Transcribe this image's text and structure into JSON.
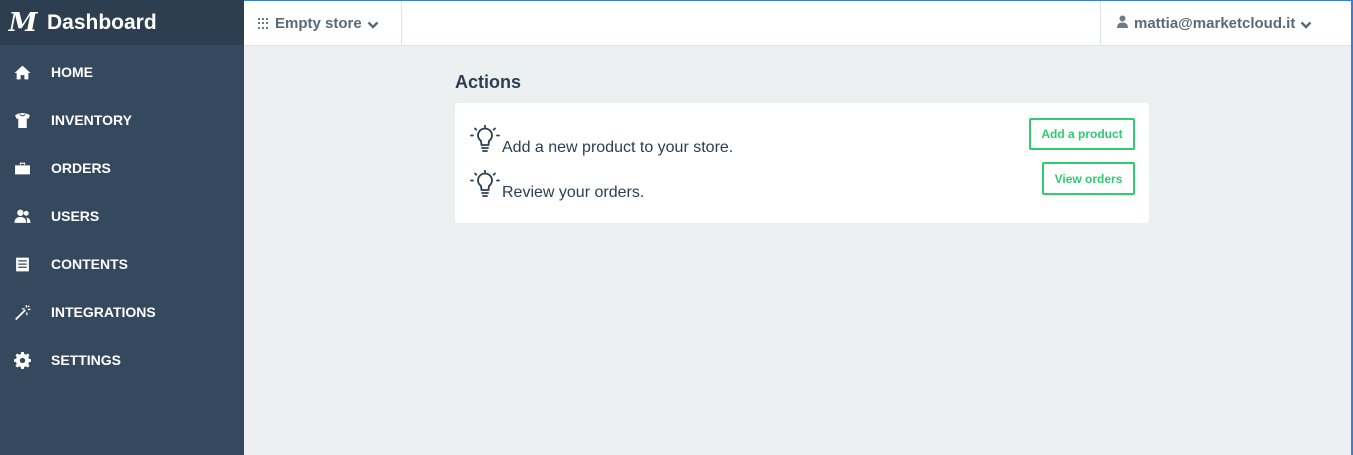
{
  "brand": {
    "logo": "M",
    "title": "Dashboard"
  },
  "sidebar": {
    "items": [
      {
        "label": "HOME",
        "icon": "home-icon"
      },
      {
        "label": "INVENTORY",
        "icon": "tshirt-icon"
      },
      {
        "label": "ORDERS",
        "icon": "briefcase-icon"
      },
      {
        "label": "USERS",
        "icon": "users-icon"
      },
      {
        "label": "CONTENTS",
        "icon": "document-icon"
      },
      {
        "label": "INTEGRATIONS",
        "icon": "magic-wand-icon"
      },
      {
        "label": "SETTINGS",
        "icon": "gear-icon"
      }
    ]
  },
  "topbar": {
    "store_name": "Empty store",
    "user_email": "mattia@marketcloud.it"
  },
  "main": {
    "section_title": "Actions",
    "actions": [
      {
        "text": "Add a new product to your store.",
        "button": "Add a product",
        "icon": "lightbulb-icon"
      },
      {
        "text": "Review your orders.",
        "button": "View orders",
        "icon": "lightbulb-icon"
      }
    ]
  },
  "colors": {
    "sidebar": "#34495e",
    "brand_bar": "#2c3e50",
    "background": "#ecf0f1",
    "accent_green": "#2ecc71",
    "text_dark": "#2c3e50"
  }
}
